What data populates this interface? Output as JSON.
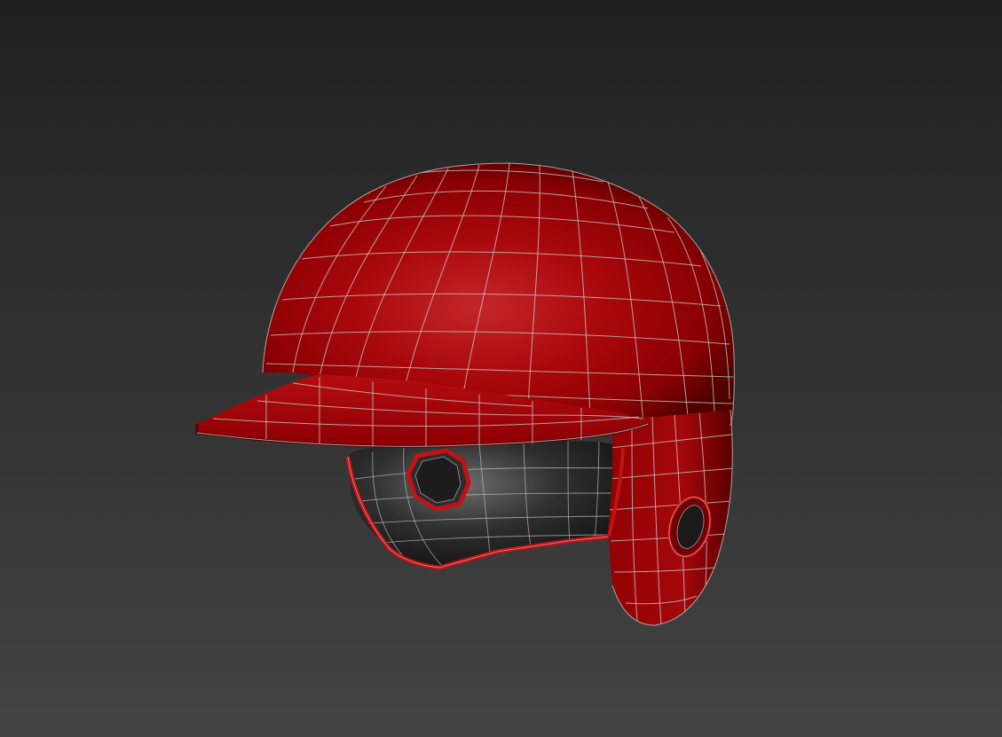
{
  "viewport": {
    "background": "#2b2b2b",
    "shading": "wireframe-on-shaded"
  },
  "model": {
    "object": "baseball-batting-helmet",
    "shell_color": "#b0090c",
    "liner_color": "#2a2a2a",
    "wire_color": "#c9c9c9"
  }
}
